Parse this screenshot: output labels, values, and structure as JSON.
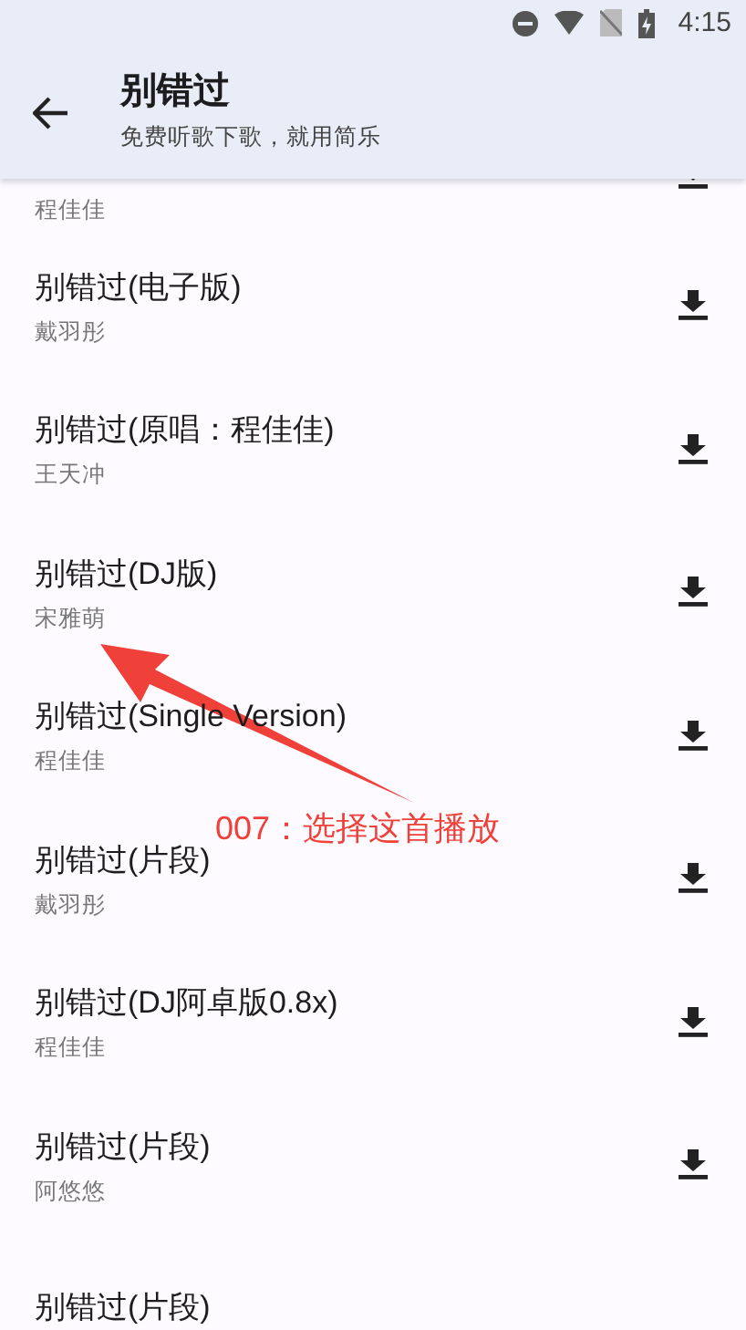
{
  "status_bar": {
    "time": "4:15"
  },
  "app_bar": {
    "title": "别错过",
    "subtitle": "免费听歌下歌，就用简乐"
  },
  "songs": [
    {
      "kind": "tail",
      "artist": "程佳佳"
    },
    {
      "kind": "full",
      "title": "别错过(电子版)",
      "artist": "戴羽彤"
    },
    {
      "kind": "full",
      "title": "别错过(原唱：程佳佳)",
      "artist": "王天冲"
    },
    {
      "kind": "full",
      "title": "别错过(DJ版)",
      "artist": "宋雅萌"
    },
    {
      "kind": "full",
      "title": "别错过(Single Version)",
      "artist": "程佳佳"
    },
    {
      "kind": "full",
      "title": "别错过(片段)",
      "artist": "戴羽彤"
    },
    {
      "kind": "full",
      "title": "别错过(DJ阿卓版0.8x)",
      "artist": "程佳佳"
    },
    {
      "kind": "full",
      "title": "别错过(片段)",
      "artist": "阿悠悠"
    },
    {
      "kind": "head",
      "title": "别错过(片段)"
    }
  ],
  "annotation": {
    "text": "007：选择这首播放"
  }
}
